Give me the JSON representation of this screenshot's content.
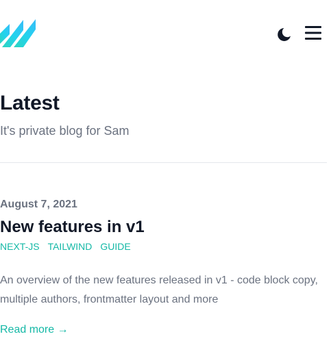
{
  "header": {
    "logo_icon": "logo-stripes-icon",
    "theme_icon": "moon-icon",
    "menu_icon": "hamburger-menu-icon",
    "logo_colors": [
      "#2dd4bf",
      "#22d3ee",
      "#38bdf8"
    ]
  },
  "hero": {
    "title": "Latest",
    "subtitle": "It's private blog for Sam"
  },
  "post": {
    "date": "August 7, 2021",
    "title": "New features in v1",
    "tags": [
      "NEXT-JS",
      "TAILWIND",
      "GUIDE"
    ],
    "summary": "An overview of the new features released in v1 - code block copy, multiple authors, frontmatter layout and more",
    "read_more": "Read more →"
  },
  "colors": {
    "accent": "#14b8a6",
    "heading": "#111827",
    "muted": "#6b7280",
    "divider": "#e5e7eb"
  }
}
